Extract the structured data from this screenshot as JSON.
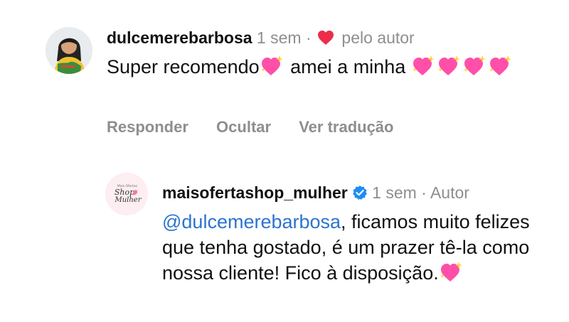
{
  "comment": {
    "username": "dulcemerebarbosa",
    "time": "1 sem",
    "separator": "·",
    "liked_by": "pelo autor",
    "text_parts": [
      "Super recomendo",
      " amei a",
      " minha "
    ],
    "actions": {
      "reply": "Responder",
      "hide": "Ocultar",
      "translate": "Ver tradução"
    }
  },
  "reply": {
    "username": "maisofertashop_mulher",
    "time": "1 sem",
    "separator": "·",
    "role": "Autor",
    "mention": "@dulcemerebarbosa",
    "text": ", ficamos muito felizes que tenha gostado, é um prazer tê-la como nossa cliente! Fico à disposição.",
    "avatar_text": {
      "top": "Mais Ofertas",
      "line1": "Shop",
      "line2": "Mulher"
    }
  },
  "colors": {
    "mention": "#2d73d0",
    "meta": "#8e8e8e",
    "heart": "#ed2d49",
    "verified": "#1f8cf3",
    "sparkling_heart": "#ff4fa8"
  },
  "icons": {
    "liked": "heart-icon",
    "verified": "verified-badge-icon",
    "emoji": "sparkling-heart-emoji"
  }
}
